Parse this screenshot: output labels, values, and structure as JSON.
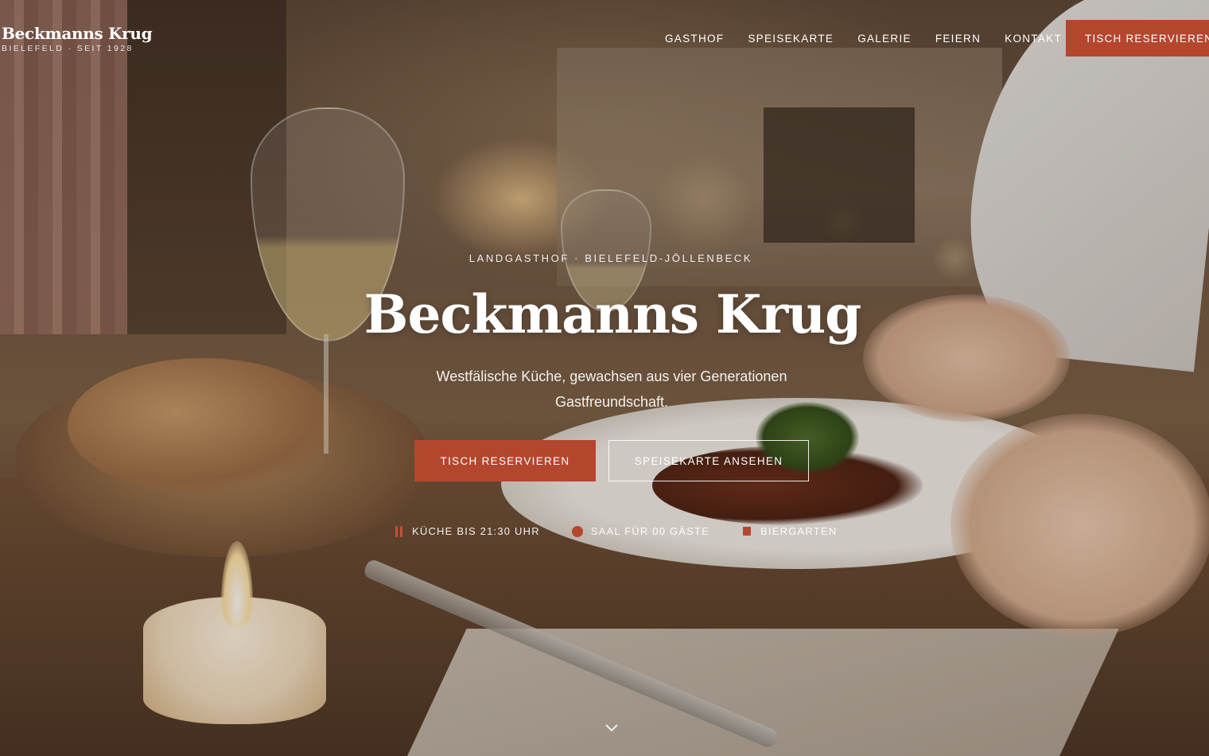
{
  "brand": {
    "name": "Beckmanns Krug",
    "subline": "BIELEFELD · SEIT 1928"
  },
  "nav": {
    "items": [
      "GASTHOF",
      "SPEISEKARTE",
      "GALERIE",
      "FEIERN",
      "KONTAKT"
    ],
    "cta_label": "TISCH RESERVIEREN"
  },
  "hero": {
    "eyebrow": "LANDGASTHOF · BIELEFELD-JÖLLENBECK",
    "title": "Beckmanns Krug",
    "tagline": "Westfälische Küche, gewachsen aus vier Generationen Gastfreundschaft.",
    "primary_button": "TISCH RESERVIEREN",
    "secondary_button": "SPEISEKARTE ANSEHEN",
    "features": [
      {
        "label": "KÜCHE BIS 21:30 UHR",
        "icon": "cutlery-icon"
      },
      {
        "label": "SAAL FÜR 00 GÄSTE",
        "icon": "hall-icon"
      },
      {
        "label": "BIERGARTEN",
        "icon": "beer-garden-icon"
      }
    ],
    "scroll_icon": "chevron-down-icon"
  },
  "colors": {
    "accent": "#b5462e",
    "text": "#ffffff"
  }
}
